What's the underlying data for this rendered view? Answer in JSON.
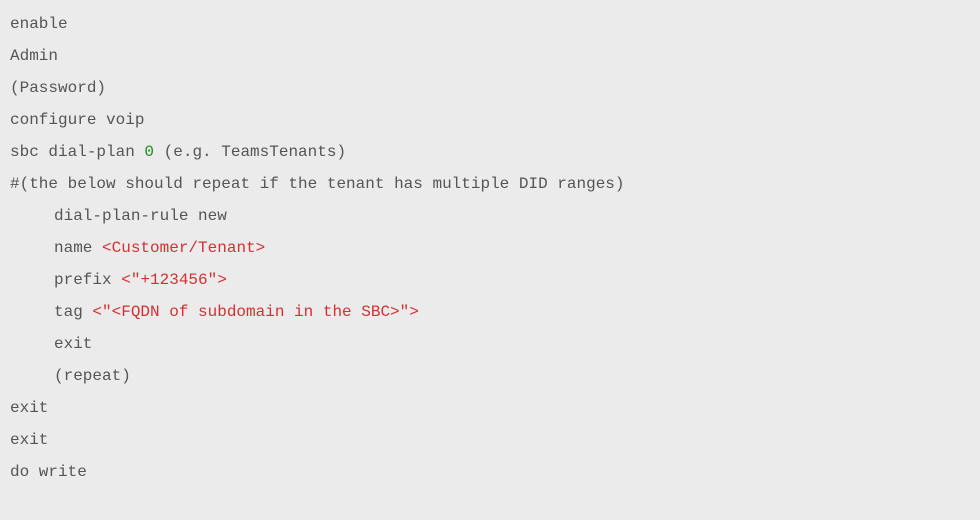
{
  "code": {
    "l1": "enable",
    "l2": "Admin",
    "l3": "(Password)",
    "l4": "configure voip",
    "l5a": "sbc dial-plan ",
    "l5b": "0",
    "l5c": " (e.g. TeamsTenants)",
    "l6": "#(the below should repeat if the tenant has multiple DID ranges)",
    "l7": "dial-plan-rule new",
    "l8a": "name ",
    "l8b": "<Customer/Tenant>",
    "l9a": "prefix ",
    "l9b": "<\"+123456\">",
    "l10a": "tag ",
    "l10b": "<\"<FQDN of subdomain in the SBC>\">",
    "l11": "exit",
    "l12": "(repeat)",
    "l13": "exit",
    "l14": "exit",
    "l15": "do write"
  }
}
